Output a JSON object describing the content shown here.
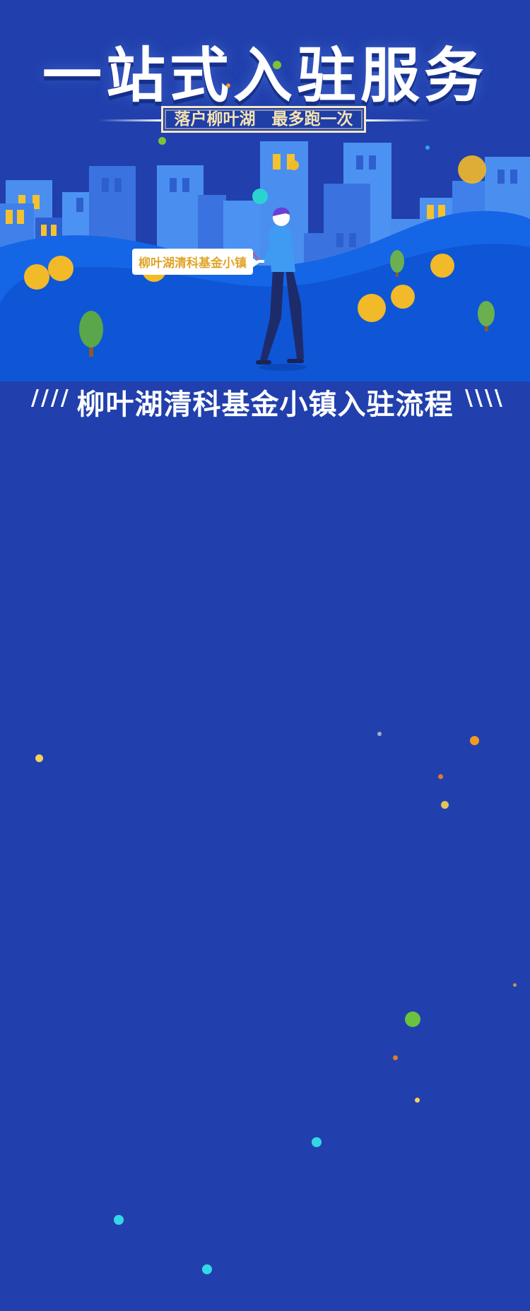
{
  "hero": {
    "title": "一站式入驻服务",
    "subtitle": "落户柳叶湖　最多跑一次"
  },
  "illustration": {
    "speech_bubble": "柳叶湖清科基金小镇",
    "coin_icon": "yuan-coin-icon"
  },
  "section": {
    "slashes_left": "////",
    "heading": "柳叶湖清科基金小镇入驻流程",
    "slashes_right": "\\\\\\\\"
  },
  "colors": {
    "background": "#2140ad",
    "building_light": "#4a8ff0",
    "building_mid": "#3a73e0",
    "hill": "#0e56d6",
    "window": "#f4c12f",
    "coin": "#f2b928",
    "subtitle_text": "#f5e3b0"
  }
}
